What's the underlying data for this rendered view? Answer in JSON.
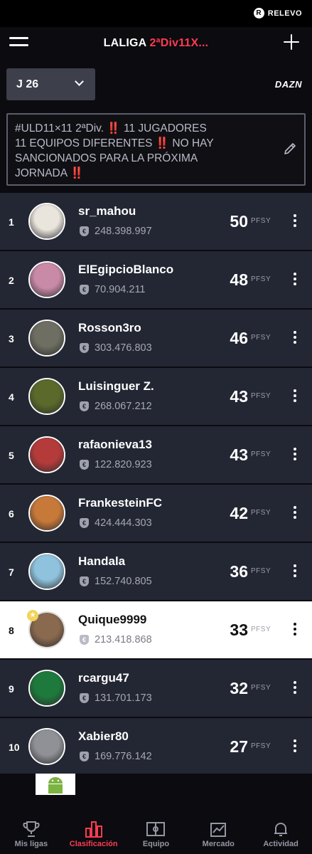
{
  "brand": {
    "name": "RELEVO",
    "mark": "R"
  },
  "header": {
    "title_main": "LALIGA ",
    "title_accent": "2ªDiv11X..."
  },
  "round": {
    "label": "J 26"
  },
  "sponsor": {
    "label": "DAZN"
  },
  "notice": {
    "text": "#ULD11×11 2ªDiv. ‼️ 11 JUGADORES\n11 EQUIPOS DIFERENTES ‼️ NO HAY\nSANCIONADOS PARA LA PRÓXIMA\nJORNADA ‼️"
  },
  "points_unit": "PFSY",
  "standings": [
    {
      "rank": "1",
      "name": "sr_mahou",
      "money": "248.398.997",
      "points": "50",
      "avatar_color": "#e9e4dc"
    },
    {
      "rank": "2",
      "name": "ElEgipcioBlanco",
      "money": "70.904.211",
      "points": "48",
      "avatar_color": "#c98aa8"
    },
    {
      "rank": "3",
      "name": "Rosson3ro",
      "money": "303.476.803",
      "points": "46",
      "avatar_color": "#6e6f62"
    },
    {
      "rank": "4",
      "name": "Luisinguer Z.",
      "money": "268.067.212",
      "points": "43",
      "avatar_color": "#5b6a2a"
    },
    {
      "rank": "5",
      "name": "rafaonieva13",
      "money": "122.820.923",
      "points": "43",
      "avatar_color": "#b53b3b"
    },
    {
      "rank": "6",
      "name": "FrankesteinFC",
      "money": "424.444.303",
      "points": "42",
      "avatar_color": "#c7793a"
    },
    {
      "rank": "7",
      "name": "Handala",
      "money": "152.740.805",
      "points": "36",
      "avatar_color": "#8fc2dc"
    },
    {
      "rank": "8",
      "name": "Quique9999",
      "money": "213.418.868",
      "points": "33",
      "avatar_color": "#8a6a4f",
      "is_current_user": true
    },
    {
      "rank": "9",
      "name": "rcargu47",
      "money": "131.701.173",
      "points": "32",
      "avatar_color": "#1e7a3c"
    },
    {
      "rank": "10",
      "name": "Xabier80",
      "money": "169.776.142",
      "points": "27",
      "avatar_color": "#8f9196"
    }
  ],
  "nav": [
    {
      "label": "Mis ligas",
      "icon": "trophy-icon"
    },
    {
      "label": "Clasificación",
      "icon": "bar-chart-icon",
      "active": true
    },
    {
      "label": "Equipo",
      "icon": "pitch-icon"
    },
    {
      "label": "Mercado",
      "icon": "market-icon"
    },
    {
      "label": "Actividad",
      "icon": "bell-icon"
    }
  ],
  "colors": {
    "accent": "#ff3b4e",
    "row_bg": "#232633",
    "page_bg": "#0b0b10"
  }
}
